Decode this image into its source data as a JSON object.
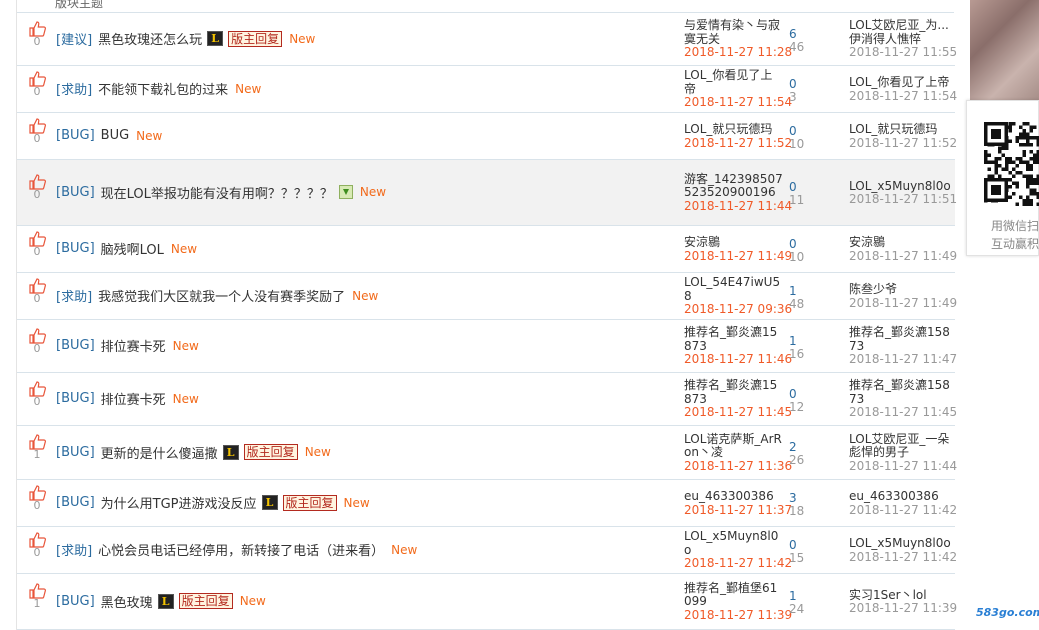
{
  "board_header": {
    "label": "版块主题"
  },
  "rows": [
    {
      "vote": "0",
      "cat": "[建议]",
      "title": "黑色玫瑰还怎么玩",
      "l_icon": true,
      "img_icon": false,
      "reply_badge": "版主回复",
      "new_label": "New",
      "author": "与爱情有染丶与寂寞无关",
      "post_time": "2018-11-27 11:28",
      "replies": "6",
      "views": "46",
      "last_user": "LOL艾欧尼亚_为...伊消得人憔悴",
      "last_time": "2018-11-27 11:55"
    },
    {
      "vote": "0",
      "cat": "[求助]",
      "title": "不能领下载礼包的过来",
      "l_icon": false,
      "img_icon": false,
      "reply_badge": "",
      "new_label": "New",
      "author": "LOL_你看见了上帝",
      "post_time": "2018-11-27 11:54",
      "replies": "0",
      "views": "3",
      "last_user": "LOL_你看见了上帝",
      "last_time": "2018-11-27 11:54"
    },
    {
      "vote": "0",
      "cat": "[BUG]",
      "title": "BUG",
      "l_icon": false,
      "img_icon": false,
      "reply_badge": "",
      "new_label": "New",
      "author": "LOL_就只玩德玛",
      "post_time": "2018-11-27 11:52",
      "replies": "0",
      "views": "10",
      "last_user": "LOL_就只玩德玛",
      "last_time": "2018-11-27 11:52"
    },
    {
      "vote": "0",
      "cat": "[BUG]",
      "title": "现在LOL举报功能有没有用啊？？？？？",
      "l_icon": false,
      "img_icon": true,
      "reply_badge": "",
      "new_label": "New",
      "author": "游客_14239850752352​0900196",
      "post_time": "2018-11-27 11:44",
      "replies": "0",
      "views": "11",
      "last_user": "LOL_x5Muyn8l0o",
      "last_time": "2018-11-27 11:51"
    },
    {
      "vote": "0",
      "cat": "[BUG]",
      "title": "脑残啊LOL",
      "l_icon": false,
      "img_icon": false,
      "reply_badge": "",
      "new_label": "New",
      "author": "安涼鶍",
      "post_time": "2018-11-27 11:49",
      "replies": "0",
      "views": "10",
      "last_user": "安涼鶍",
      "last_time": "2018-11-27 11:49"
    },
    {
      "vote": "0",
      "cat": "[求助]",
      "title": "我感觉我们大区就我一个人没有赛季奖励了",
      "l_icon": false,
      "img_icon": false,
      "reply_badge": "",
      "new_label": "New",
      "author": "LOL_54E47iwU58",
      "post_time": "2018-11-27 09:36",
      "replies": "1",
      "views": "48",
      "last_user": "陈叁少爷",
      "last_time": "2018-11-27 11:49"
    },
    {
      "vote": "0",
      "cat": "[BUG]",
      "title": "排位赛卡死",
      "l_icon": false,
      "img_icon": false,
      "reply_badge": "",
      "new_label": "New",
      "author": "推荐名_鄞炎瀌15873",
      "post_time": "2018-11-27 11:46",
      "replies": "1",
      "views": "16",
      "last_user": "推荐名_鄞炎瀌15873",
      "last_time": "2018-11-27 11:47"
    },
    {
      "vote": "0",
      "cat": "[BUG]",
      "title": "排位赛卡死",
      "l_icon": false,
      "img_icon": false,
      "reply_badge": "",
      "new_label": "New",
      "author": "推荐名_鄞炎瀌15873",
      "post_time": "2018-11-27 11:45",
      "replies": "0",
      "views": "12",
      "last_user": "推荐名_鄞炎瀌15873",
      "last_time": "2018-11-27 11:45"
    },
    {
      "vote": "1",
      "cat": "[BUG]",
      "title": "更新的是什么傻逼撒",
      "l_icon": true,
      "img_icon": false,
      "reply_badge": "版主回复",
      "new_label": "New",
      "author": "LOL诺克萨斯_ArRon丶凌",
      "post_time": "2018-11-27 11:36",
      "replies": "2",
      "views": "26",
      "last_user": "LOL艾欧尼亚_一朵彪悍的男子",
      "last_time": "2018-11-27 11:44"
    },
    {
      "vote": "0",
      "cat": "[BUG]",
      "title": "为什么用TGP进游戏没反应",
      "l_icon": true,
      "img_icon": false,
      "reply_badge": "版主回复",
      "new_label": "New",
      "author": "eu_463300386",
      "post_time": "2018-11-27 11:37",
      "replies": "3",
      "views": "18",
      "last_user": "eu_463300386",
      "last_time": "2018-11-27 11:42"
    },
    {
      "vote": "0",
      "cat": "[求助]",
      "title": "心悦会员电话已经停用，新转接了电话（进来看）",
      "l_icon": false,
      "img_icon": false,
      "reply_badge": "",
      "new_label": "New",
      "author": "LOL_x5Muyn8l0o",
      "post_time": "2018-11-27 11:42",
      "replies": "0",
      "views": "15",
      "last_user": "LOL_x5Muyn8l0o",
      "last_time": "2018-11-27 11:42"
    },
    {
      "vote": "1",
      "cat": "[BUG]",
      "title": "黑色玫瑰",
      "l_icon": true,
      "img_icon": false,
      "reply_badge": "版主回复",
      "new_label": "New",
      "author": "推荐名_鄞植堡61099",
      "post_time": "2018-11-27 11:39",
      "replies": "1",
      "views": "24",
      "last_user": "实习1Ser丶lol",
      "last_time": "2018-11-27 11:39"
    }
  ],
  "sidebar": {
    "qr_caption_1": "用微信扫",
    "qr_caption_2": "互动赢积",
    "watermark": "583go.com"
  }
}
